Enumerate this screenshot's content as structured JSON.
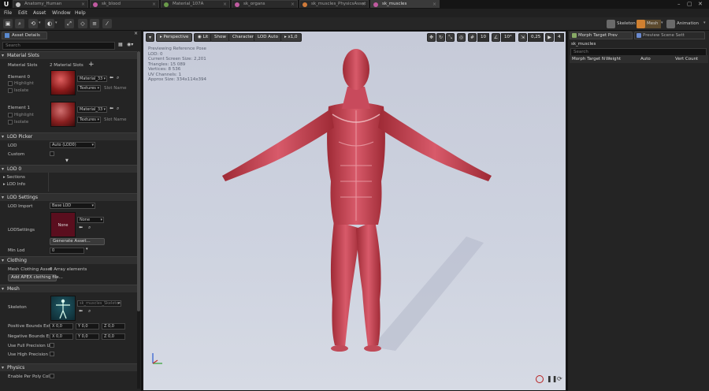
{
  "tabs": [
    {
      "label": "Anatomy_Human",
      "color": "#c0c0c0"
    },
    {
      "label": "sk_blood",
      "color": "#c05aa0"
    },
    {
      "label": "Material_107A",
      "color": "#6a9a4a"
    },
    {
      "label": "sk_organs",
      "color": "#c05aa0"
    },
    {
      "label": "sk_muscles_PhysicsAsset",
      "color": "#d07a3a"
    },
    {
      "label": "sk_muscles",
      "color": "#c05aa0"
    }
  ],
  "menu": [
    "File",
    "Edit",
    "Asset",
    "Window",
    "Help"
  ],
  "modes": {
    "skeleton": "Skeleton",
    "mesh": "Mesh",
    "animation": "Animation"
  },
  "left_panel": {
    "tab_label": "Asset Details",
    "search_placeholder": "Search",
    "material_slots": {
      "header": "Material Slots",
      "label": "Material Slots",
      "count": "2 Material Slots",
      "elements": [
        {
          "name": "Element 0",
          "highlight": "Highlight",
          "isolate": "Isolate",
          "material": "Material_33",
          "textures": "Textures",
          "slot_name": "Slot Name"
        },
        {
          "name": "Element 1",
          "highlight": "Highlight",
          "isolate": "Isolate",
          "material": "Material_33",
          "textures": "Textures",
          "slot_name": "Slot Name"
        }
      ]
    },
    "lod_picker": {
      "header": "LOD Picker",
      "lod_label": "LOD",
      "lod_value": "Auto (LOD0)",
      "custom_label": "Custom"
    },
    "lod0": {
      "header": "LOD 0",
      "sections": "Sections",
      "lod_info": "LOD Info"
    },
    "lod_settings": {
      "header": "LOD Settings",
      "lod_import": "LOD Import",
      "lod_import_value": "Base LOD",
      "lod_settings_label": "LODSettings",
      "asset_none": "None",
      "asset_dd": "None",
      "generate": "Generate Asset...",
      "min_lod": "Min Lod",
      "min_lod_value": "0"
    },
    "clothing": {
      "header": "Clothing",
      "mesh_clothing": "Mesh Clothing Asset",
      "array": "0 Array elements",
      "add_btn": "Add APEX clothing file..."
    },
    "mesh": {
      "header": "Mesh",
      "skeleton_label": "Skeleton",
      "skeleton_value": "sk_muscles_Skeleton",
      "pos_bounds": "Positive Bounds Exte",
      "neg_bounds": "Negative Bounds Ext",
      "x": "X",
      "y": "Y",
      "z": "Z",
      "pos_values": [
        "0,0",
        "0,0",
        "0,0"
      ],
      "neg_values": [
        "0,0",
        "0,0",
        "0,0"
      ],
      "full_precision": "Use Full Precision UV",
      "high_precision": "Use High Precision Ta"
    },
    "physics": {
      "header": "Physics",
      "per_poly": "Enable Per Poly Collis"
    }
  },
  "viewport": {
    "perspective": "Perspective",
    "lit": "Lit",
    "show": "Show",
    "character": "Character",
    "lod_auto": "LOD Auto",
    "speed": "x1,0",
    "grid_snap": "10",
    "rot_snap": "10°",
    "scale_snap": "0,25",
    "cam_speed": "4",
    "stats": [
      "Previewing Reference Pose",
      "LOD: 0",
      "Current Screen Size: 2,201",
      "Triangles: 15 089",
      "Vertices: 8 536",
      "UV Channels: 1",
      "Approx Size: 334x114x394"
    ]
  },
  "right_panel": {
    "tabs": [
      "Morph Target Prev",
      "Preview Scene Sett"
    ],
    "asset_name": "sk_muscles",
    "search_placeholder": "Search",
    "columns": [
      "Morph Target N",
      "Weight",
      "Auto",
      "Vert Count"
    ]
  }
}
